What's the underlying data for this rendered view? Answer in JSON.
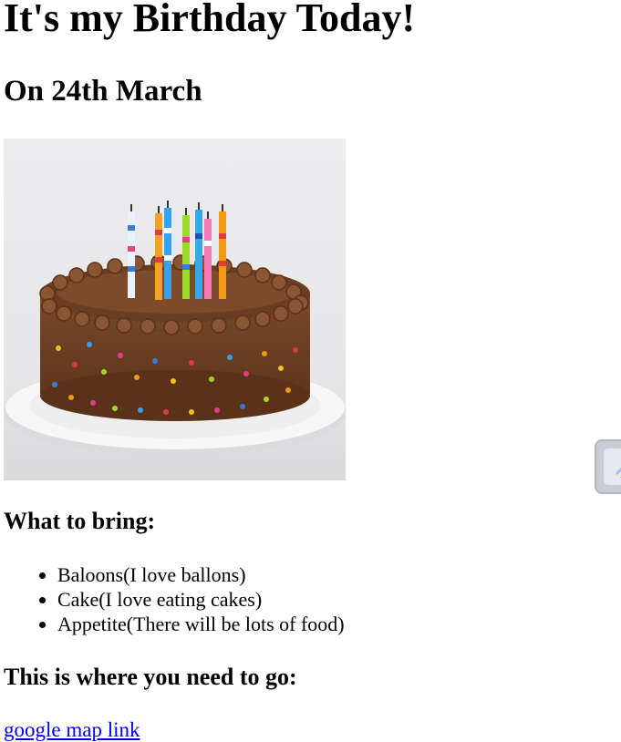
{
  "heading": "It's my Birthday Today!",
  "subheading": "On 24th March",
  "bring": {
    "title": "What to bring:",
    "items": [
      "Baloons(I love ballons)",
      "Cake(I love eating cakes)",
      "Appetite(There will be lots of food)"
    ]
  },
  "location": {
    "title": "This is where you need to go:",
    "link_text": "google map link"
  }
}
